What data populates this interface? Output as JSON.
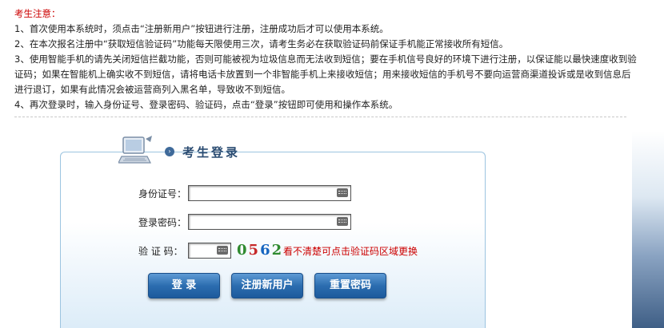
{
  "notice": {
    "title": "考生注意：",
    "items": [
      "1、首次使用本系统时，须点击“注册新用户”按钮进行注册，注册成功后才可以使用本系统。",
      "2、在本次报名注册中“获取短信验证码”功能每天限使用三次，请考生务必在获取验证码前保证手机能正常接收所有短信。",
      "3、使用智能手机的请先关闭短信拦截功能，否则可能被视为垃圾信息而无法收到短信；要在手机信号良好的环境下进行注册，以保证能以最快速度收到验证码；如果在智能机上确实收不到短信，请将电话卡放置到一个非智能手机上来接收短信；用来接收短信的手机号不要向运营商渠道投诉或是收到信息后进行退订，如果有此情况会被运营商列入黑名单，导致收不到短信。",
      "4、再次登录时，输入身份证号、登录密码、验证码，点击“登录”按钮即可使用和操作本系统。"
    ]
  },
  "login": {
    "title": "考生登录",
    "id_label": "身份证号：",
    "id_value": "",
    "password_label": "登录密码：",
    "password_value": "",
    "captcha_label": "验 证 码：",
    "captcha_value": "",
    "captcha_code": [
      "0",
      "5",
      "6",
      "2"
    ],
    "captcha_hint": "看不清楚可点击验证码区域更换"
  },
  "buttons": {
    "login": "登 录",
    "register": "注册新用户",
    "reset_password": "重置密码"
  }
}
